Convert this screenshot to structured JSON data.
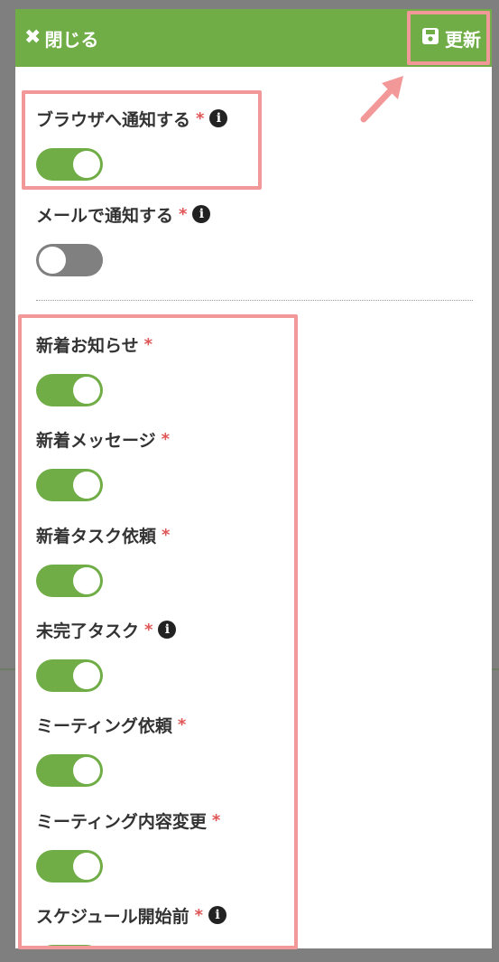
{
  "header": {
    "close_label": "閉じる",
    "save_label": "更新",
    "background": "#70ad47"
  },
  "colors": {
    "toggle_on": "#70ad47",
    "toggle_off": "#808080",
    "highlight": "#f39898",
    "required": "#e05555"
  },
  "required_mark": "*",
  "settings": [
    {
      "label": "ブラウザへ通知する",
      "required": true,
      "info": true,
      "state": "on"
    },
    {
      "label": "メールで通知する",
      "required": true,
      "info": true,
      "state": "off"
    },
    {
      "label": "新着お知らせ",
      "required": true,
      "info": false,
      "state": "on"
    },
    {
      "label": "新着メッセージ",
      "required": true,
      "info": false,
      "state": "on"
    },
    {
      "label": "新着タスク依頼",
      "required": true,
      "info": false,
      "state": "on"
    },
    {
      "label": "未完了タスク",
      "required": true,
      "info": true,
      "state": "on"
    },
    {
      "label": "ミーティング依頼",
      "required": true,
      "info": false,
      "state": "on"
    },
    {
      "label": "ミーティング内容変更",
      "required": true,
      "info": false,
      "state": "on"
    },
    {
      "label": "スケジュール開始前",
      "required": true,
      "info": true,
      "state": "on"
    }
  ]
}
